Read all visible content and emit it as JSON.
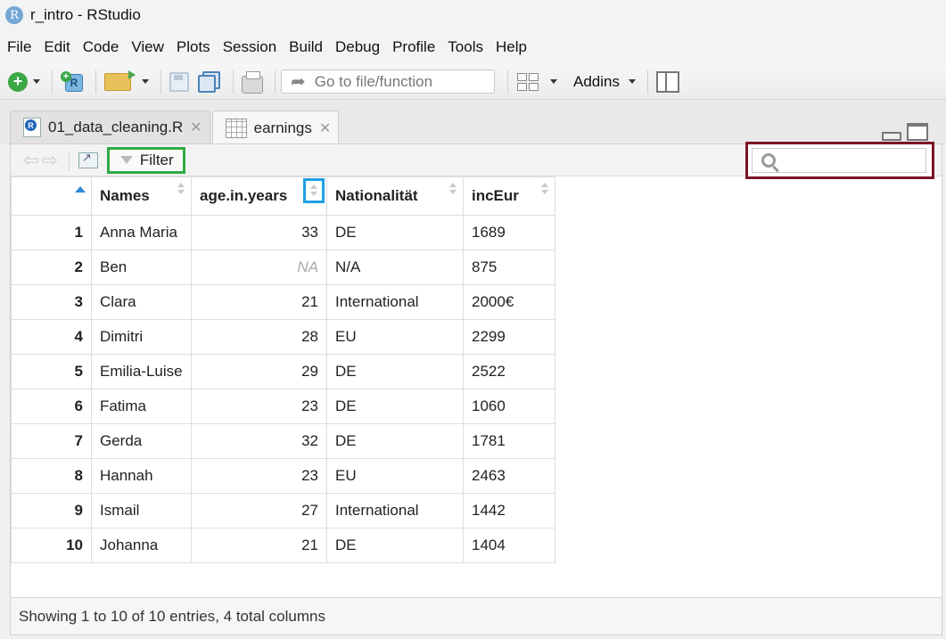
{
  "window": {
    "logo_letter": "R",
    "title": "r_intro - RStudio"
  },
  "menu": [
    "File",
    "Edit",
    "Code",
    "View",
    "Plots",
    "Session",
    "Build",
    "Debug",
    "Profile",
    "Tools",
    "Help"
  ],
  "toolbar": {
    "goto_placeholder": "Go to file/function",
    "addins_label": "Addins"
  },
  "tabs": [
    {
      "label": "01_data_cleaning.R",
      "icon": "r-script-icon",
      "active": false
    },
    {
      "label": "earnings",
      "icon": "data-grid-icon",
      "active": true
    }
  ],
  "viewer": {
    "filter_label": "Filter",
    "search_value": "",
    "columns": [
      "Names",
      "age.in.years",
      "Nationalität",
      "incEur"
    ],
    "rows": [
      {
        "n": "1",
        "name": "Anna Maria",
        "age": "33",
        "nat": "DE",
        "inc": "1689"
      },
      {
        "n": "2",
        "name": "Ben",
        "age": "NA",
        "nat": "N/A",
        "inc": "875"
      },
      {
        "n": "3",
        "name": "Clara",
        "age": "21",
        "nat": "International",
        "inc": "2000€"
      },
      {
        "n": "4",
        "name": "Dimitri",
        "age": "28",
        "nat": "EU",
        "inc": "2299"
      },
      {
        "n": "5",
        "name": "Emilia-Luise",
        "age": "29",
        "nat": "DE",
        "inc": "2522"
      },
      {
        "n": "6",
        "name": "Fatima",
        "age": "23",
        "nat": "DE",
        "inc": "1060"
      },
      {
        "n": "7",
        "name": "Gerda",
        "age": "32",
        "nat": "DE",
        "inc": "1781"
      },
      {
        "n": "8",
        "name": "Hannah",
        "age": "23",
        "nat": "EU",
        "inc": "2463"
      },
      {
        "n": "9",
        "name": "Ismail",
        "age": "27",
        "nat": "International",
        "inc": "1442"
      },
      {
        "n": "10",
        "name": "Johanna",
        "age": "21",
        "nat": "DE",
        "inc": "1404"
      }
    ],
    "status": "Showing 1 to 10 of 10 entries, 4 total columns"
  },
  "colors": {
    "filter_highlight": "#2eab45",
    "search_highlight": "#7b1523",
    "sort_highlight": "#1fa0e6"
  }
}
